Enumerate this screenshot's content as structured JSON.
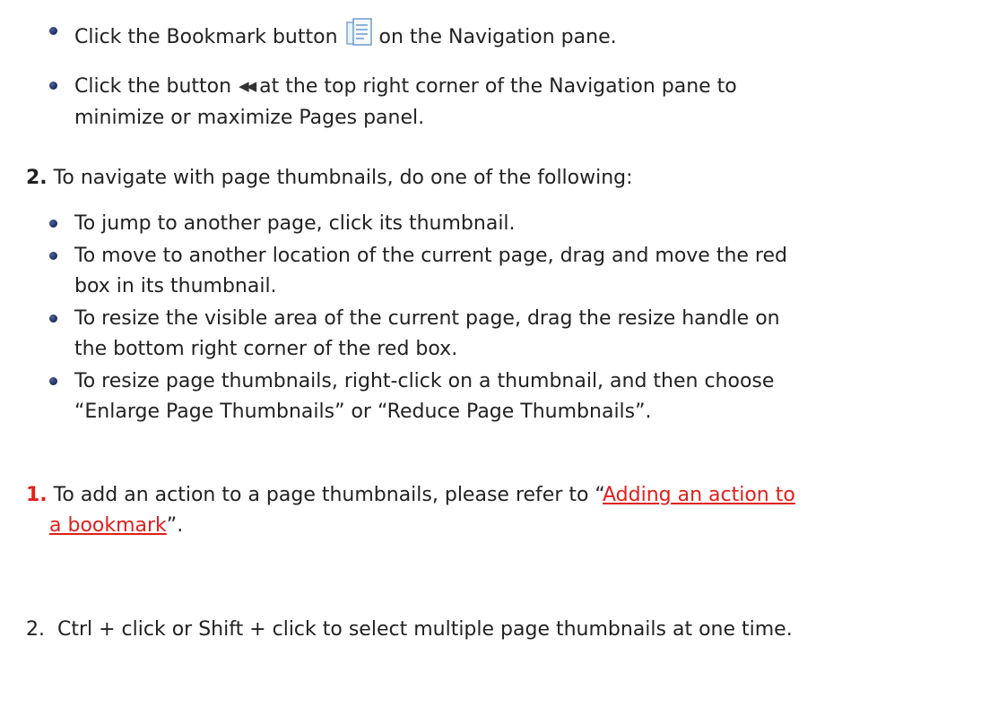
{
  "bullets_top": [
    {
      "pre": "Click the Bookmark button",
      "icon": "bookmark-pages-icon",
      "post": "on the Navigation pane."
    },
    {
      "pre": "Click the button",
      "icon": "collapse-pane-icon",
      "post": "at the top right corner of the Navigation pane to",
      "cont": "minimize or maximize Pages panel."
    }
  ],
  "step2": {
    "number": "2.",
    "text": "To navigate with page thumbnails, do one of the following:",
    "bullets": [
      {
        "l1": "To jump to another page, click its thumbnail."
      },
      {
        "l1": "To move to another location of the current page, drag and move the red",
        "l2": "box in its thumbnail."
      },
      {
        "l1": "To resize the visible area of the current page, drag the resize handle on",
        "l2": "the bottom right corner of the red box."
      },
      {
        "l1": "To resize page thumbnails, right-click on a thumbnail, and then choose",
        "l2": "“Enlarge Page Thumbnails” or “Reduce Page Thumbnails”."
      }
    ]
  },
  "note1": {
    "number": "1.",
    "pre": "To add an action to a page thumbnails, please refer to “",
    "link_a": "Adding an action to",
    "link_b": "a bookmark",
    "post": "”."
  },
  "note2": {
    "text": "2.  Ctrl + click or Shift + click to select multiple page thumbnails at one time."
  },
  "colors": {
    "accent_red": "#e0201c",
    "text": "#222222",
    "bullet": "#1c2b5c"
  }
}
